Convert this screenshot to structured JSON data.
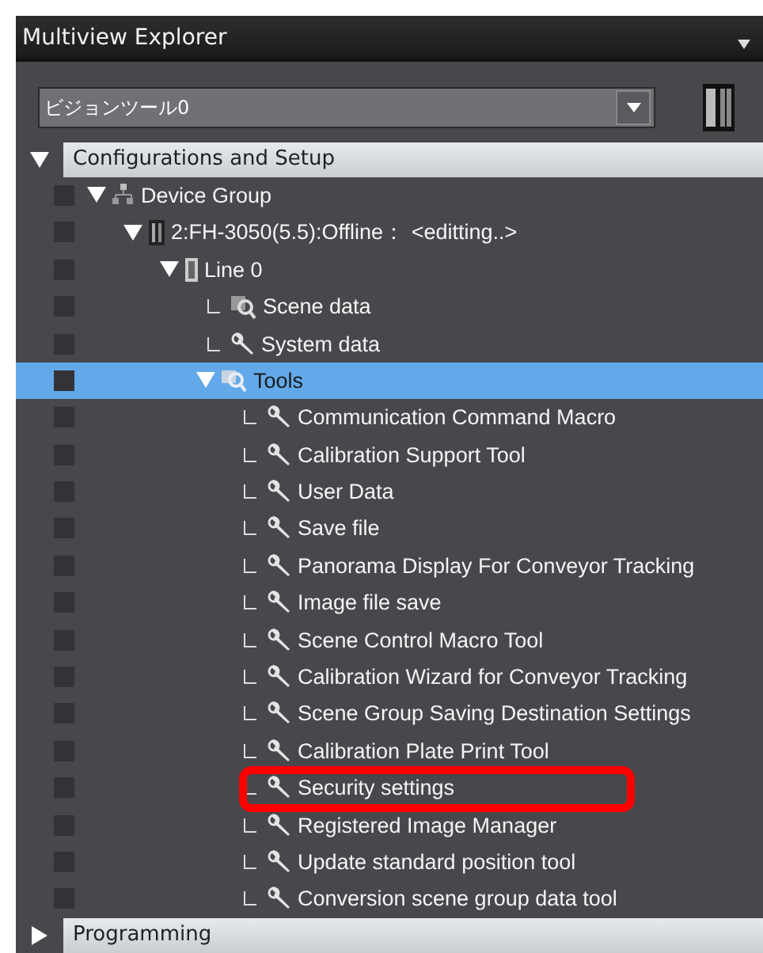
{
  "window": {
    "title": "Multiview Explorer"
  },
  "selector": {
    "value": "ビジョンツール0"
  },
  "sections": [
    {
      "label": "Configurations and Setup",
      "expanded": true,
      "tree": [
        {
          "label": "Device Group",
          "kind": "network",
          "expanded": true,
          "selected": false,
          "children": [
            {
              "label": "2:FH-3050(5.5):Offline： <editting..>",
              "kind": "controller",
              "expanded": true,
              "selected": false,
              "children": [
                {
                  "label": "Line 0",
                  "kind": "line",
                  "expanded": true,
                  "selected": false,
                  "children": [
                    {
                      "label": "Scene data",
                      "kind": "scene",
                      "selected": false
                    },
                    {
                      "label": "System data",
                      "kind": "wrench",
                      "selected": false
                    },
                    {
                      "label": "Tools",
                      "kind": "tools",
                      "expanded": true,
                      "selected": true,
                      "children": [
                        {
                          "label": "Communication Command Macro",
                          "kind": "wrench",
                          "selected": false
                        },
                        {
                          "label": "Calibration Support Tool",
                          "kind": "wrench",
                          "selected": false
                        },
                        {
                          "label": "User Data",
                          "kind": "wrench",
                          "selected": false
                        },
                        {
                          "label": "Save file",
                          "kind": "wrench",
                          "selected": false
                        },
                        {
                          "label": "Panorama Display For Conveyor Tracking",
                          "kind": "wrench",
                          "selected": false
                        },
                        {
                          "label": "Image file save",
                          "kind": "wrench",
                          "selected": false
                        },
                        {
                          "label": "Scene Control Macro Tool",
                          "kind": "wrench",
                          "selected": false
                        },
                        {
                          "label": "Calibration Wizard for Conveyor Tracking",
                          "kind": "wrench",
                          "selected": false
                        },
                        {
                          "label": "Scene Group Saving Destination Settings",
                          "kind": "wrench",
                          "selected": false
                        },
                        {
                          "label": "Calibration Plate Print Tool",
                          "kind": "wrench",
                          "selected": false
                        },
                        {
                          "label": "Security settings",
                          "kind": "wrench",
                          "selected": false,
                          "highlighted": true
                        },
                        {
                          "label": "Registered Image Manager",
                          "kind": "wrench",
                          "selected": false
                        },
                        {
                          "label": "Update standard position tool",
                          "kind": "wrench",
                          "selected": false
                        },
                        {
                          "label": "Conversion scene group data tool",
                          "kind": "wrench",
                          "selected": false
                        }
                      ]
                    }
                  ]
                }
              ]
            }
          ]
        }
      ]
    },
    {
      "label": "Programming",
      "expanded": false
    }
  ]
}
